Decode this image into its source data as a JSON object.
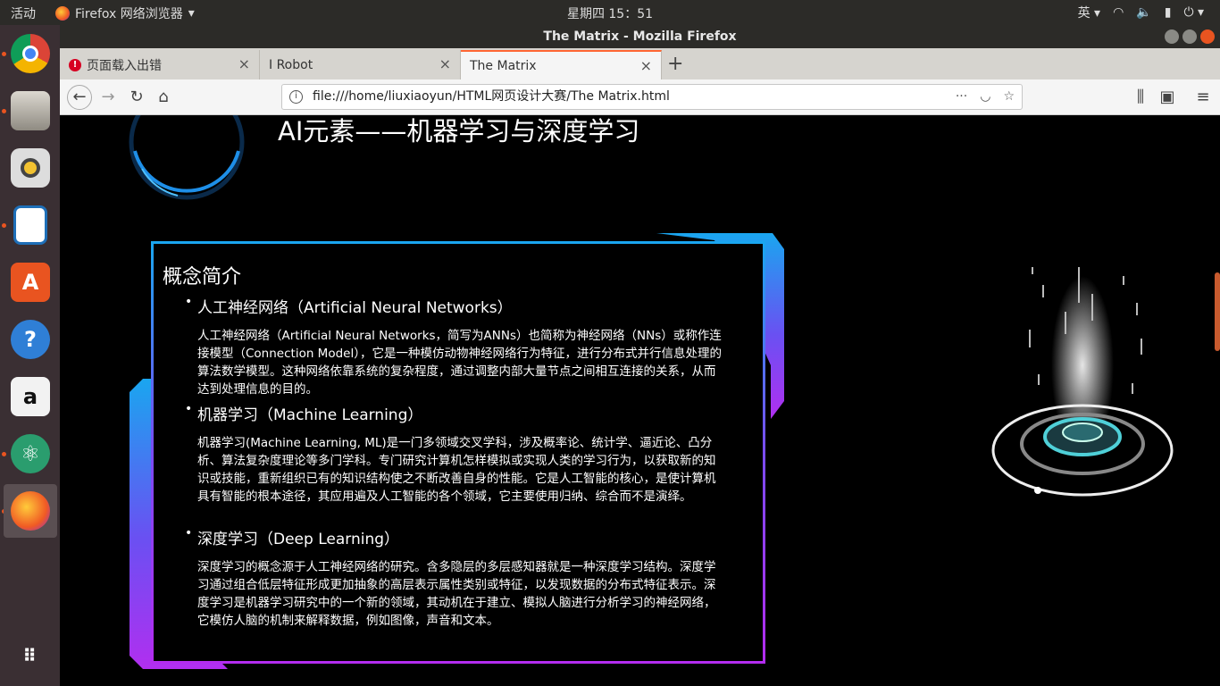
{
  "topbar": {
    "activities": "活动",
    "app_name": "Firefox 网络浏览器",
    "clock": "星期四 15：51",
    "ime": "英"
  },
  "window": {
    "title": "The Matrix - Mozilla Firefox"
  },
  "tabs": [
    {
      "label": "页面载入出错",
      "error": true
    },
    {
      "label": "I Robot",
      "error": false
    },
    {
      "label": "The Matrix",
      "error": false,
      "active": true
    }
  ],
  "nav": {
    "url": "file:///home/liuxiaoyun/HTML网页设计大赛/The Matrix.html"
  },
  "page": {
    "heading": "AI元素——机器学习与深度学习",
    "card_title": "概念简介",
    "sections": [
      {
        "title": "人工神经网络（Artificial Neural Networks）",
        "body": "人工神经网络（Artificial Neural Networks，简写为ANNs）也简称为神经网络（NNs）或称作连接模型（Connection Model），它是一种模仿动物神经网络行为特征，进行分布式并行信息处理的算法数学模型。这种网络依靠系统的复杂程度，通过调整内部大量节点之间相互连接的关系，从而达到处理信息的目的。"
      },
      {
        "title": "机器学习（Machine Learning）",
        "body": "机器学习(Machine Learning, ML)是一门多领域交叉学科，涉及概率论、统计学、逼近论、凸分析、算法复杂度理论等多门学科。专门研究计算机怎样模拟或实现人类的学习行为，以获取新的知识或技能，重新组织已有的知识结构使之不断改善自身的性能。它是人工智能的核心，是使计算机具有智能的根本途径，其应用遍及人工智能的各个领域，它主要使用归纳、综合而不是演绎。"
      },
      {
        "title": "深度学习（Deep Learning）",
        "body": "深度学习的概念源于人工神经网络的研究。含多隐层的多层感知器就是一种深度学习结构。深度学习通过组合低层特征形成更加抽象的高层表示属性类别或特征，以发现数据的分布式特征表示。深度学习是机器学习研究中的一个新的领域，其动机在于建立、模拟人脑进行分析学习的神经网络，它模仿人脑的机制来解释数据，例如图像，声音和文本。"
      }
    ]
  },
  "colors": {
    "accent": "#e95420",
    "card_top": "#1aa6f0",
    "card_bottom": "#b32cf0"
  }
}
